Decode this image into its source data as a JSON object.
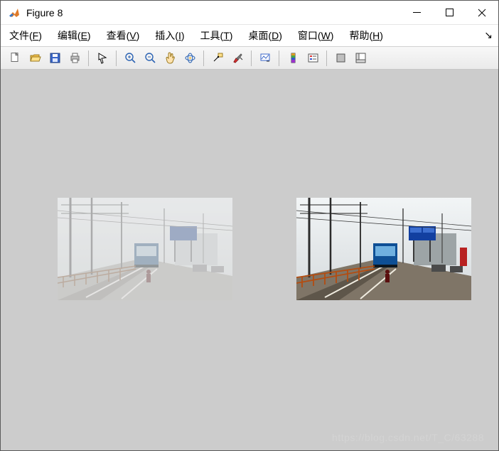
{
  "titlebar": {
    "title": "Figure 8"
  },
  "menu": {
    "file": {
      "label": "文件(",
      "mnemonic": "F",
      "suffix": ")"
    },
    "edit": {
      "label": "编辑(",
      "mnemonic": "E",
      "suffix": ")"
    },
    "view": {
      "label": "查看(",
      "mnemonic": "V",
      "suffix": ")"
    },
    "insert": {
      "label": "插入(",
      "mnemonic": "I",
      "suffix": ")"
    },
    "tools": {
      "label": "工具(",
      "mnemonic": "T",
      "suffix": ")"
    },
    "desktop": {
      "label": "桌面(",
      "mnemonic": "D",
      "suffix": ")"
    },
    "window": {
      "label": "窗口(",
      "mnemonic": "W",
      "suffix": ")"
    },
    "help": {
      "label": "帮助(",
      "mnemonic": "H",
      "suffix": ")"
    }
  },
  "toolbar_icons": {
    "new": "new-file-icon",
    "open": "open-folder-icon",
    "save": "save-icon",
    "print": "print-icon",
    "pointer": "pointer-icon",
    "zoom_in": "zoom-in-icon",
    "zoom_out": "zoom-out-icon",
    "pan": "pan-hand-icon",
    "rotate3d": "rotate3d-icon",
    "datatip": "data-cursor-icon",
    "brush": "brush-icon",
    "link": "link-plots-icon",
    "colorbar": "colorbar-icon",
    "legend": "legend-icon",
    "hide": "hide-plot-tools-icon",
    "show": "show-plot-tools-icon"
  },
  "watermark": "https://blog.csdn.net/T_C/63288"
}
